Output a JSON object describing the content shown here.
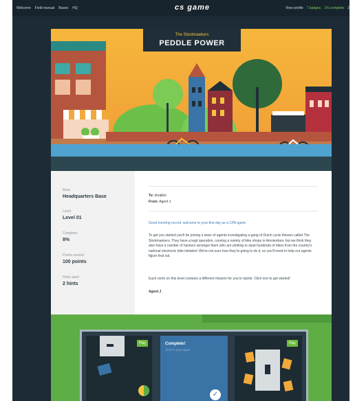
{
  "nav": {
    "left": [
      "Welcome",
      "Field manual",
      "Bases",
      "HQ"
    ],
    "logo": "cs game",
    "right": [
      "View profile",
      "7 badges",
      "1% complete",
      "2"
    ]
  },
  "hero": {
    "subtitle": "The Slootmaekers",
    "title": "PEDDLE POWER"
  },
  "stats": [
    {
      "label": "Base",
      "value": "Headquarters Base"
    },
    {
      "label": "Level",
      "value": "Level 01"
    },
    {
      "label": "Complete",
      "value": "8%"
    },
    {
      "label": "Points earned",
      "value": "100 points"
    },
    {
      "label": "Hints used",
      "value": "2 hints"
    }
  ],
  "message": {
    "to_label": "To:",
    "to": "timalkin",
    "from_label": "From:",
    "from": "Agent J",
    "greeting": "Good morning recruit, welcome to your first day as a CPA agent.",
    "body1": "To get you started you'll be joining a team of agents investigating a gang of Dutch cycle thieves called The Slootmaekers. They have a legit operation, running a variety of bike shops in Amsterdam, but we think they also have a number of hackers amongst them who are plotting to steal hundreds of bikes from the country's national electronic bike initiative! We're not sure how they're going to do it, so you'll need to help our agents figure that out.",
    "body2": "Each room on this level contains a different mission for you to tackle. Click one to get started!",
    "signature": "Agent J"
  },
  "rooms": [
    {
      "play": "Play"
    },
    {
      "complete": "Complete!",
      "sub": "Click to play again"
    },
    {
      "play": "Play"
    }
  ],
  "colors": {
    "page_bg": "#1c2b36",
    "sky": "#f2a93b",
    "accent_green": "#6dbb3d",
    "complete_blue": "#3a73a6",
    "link_blue": "#3a7ab8"
  }
}
